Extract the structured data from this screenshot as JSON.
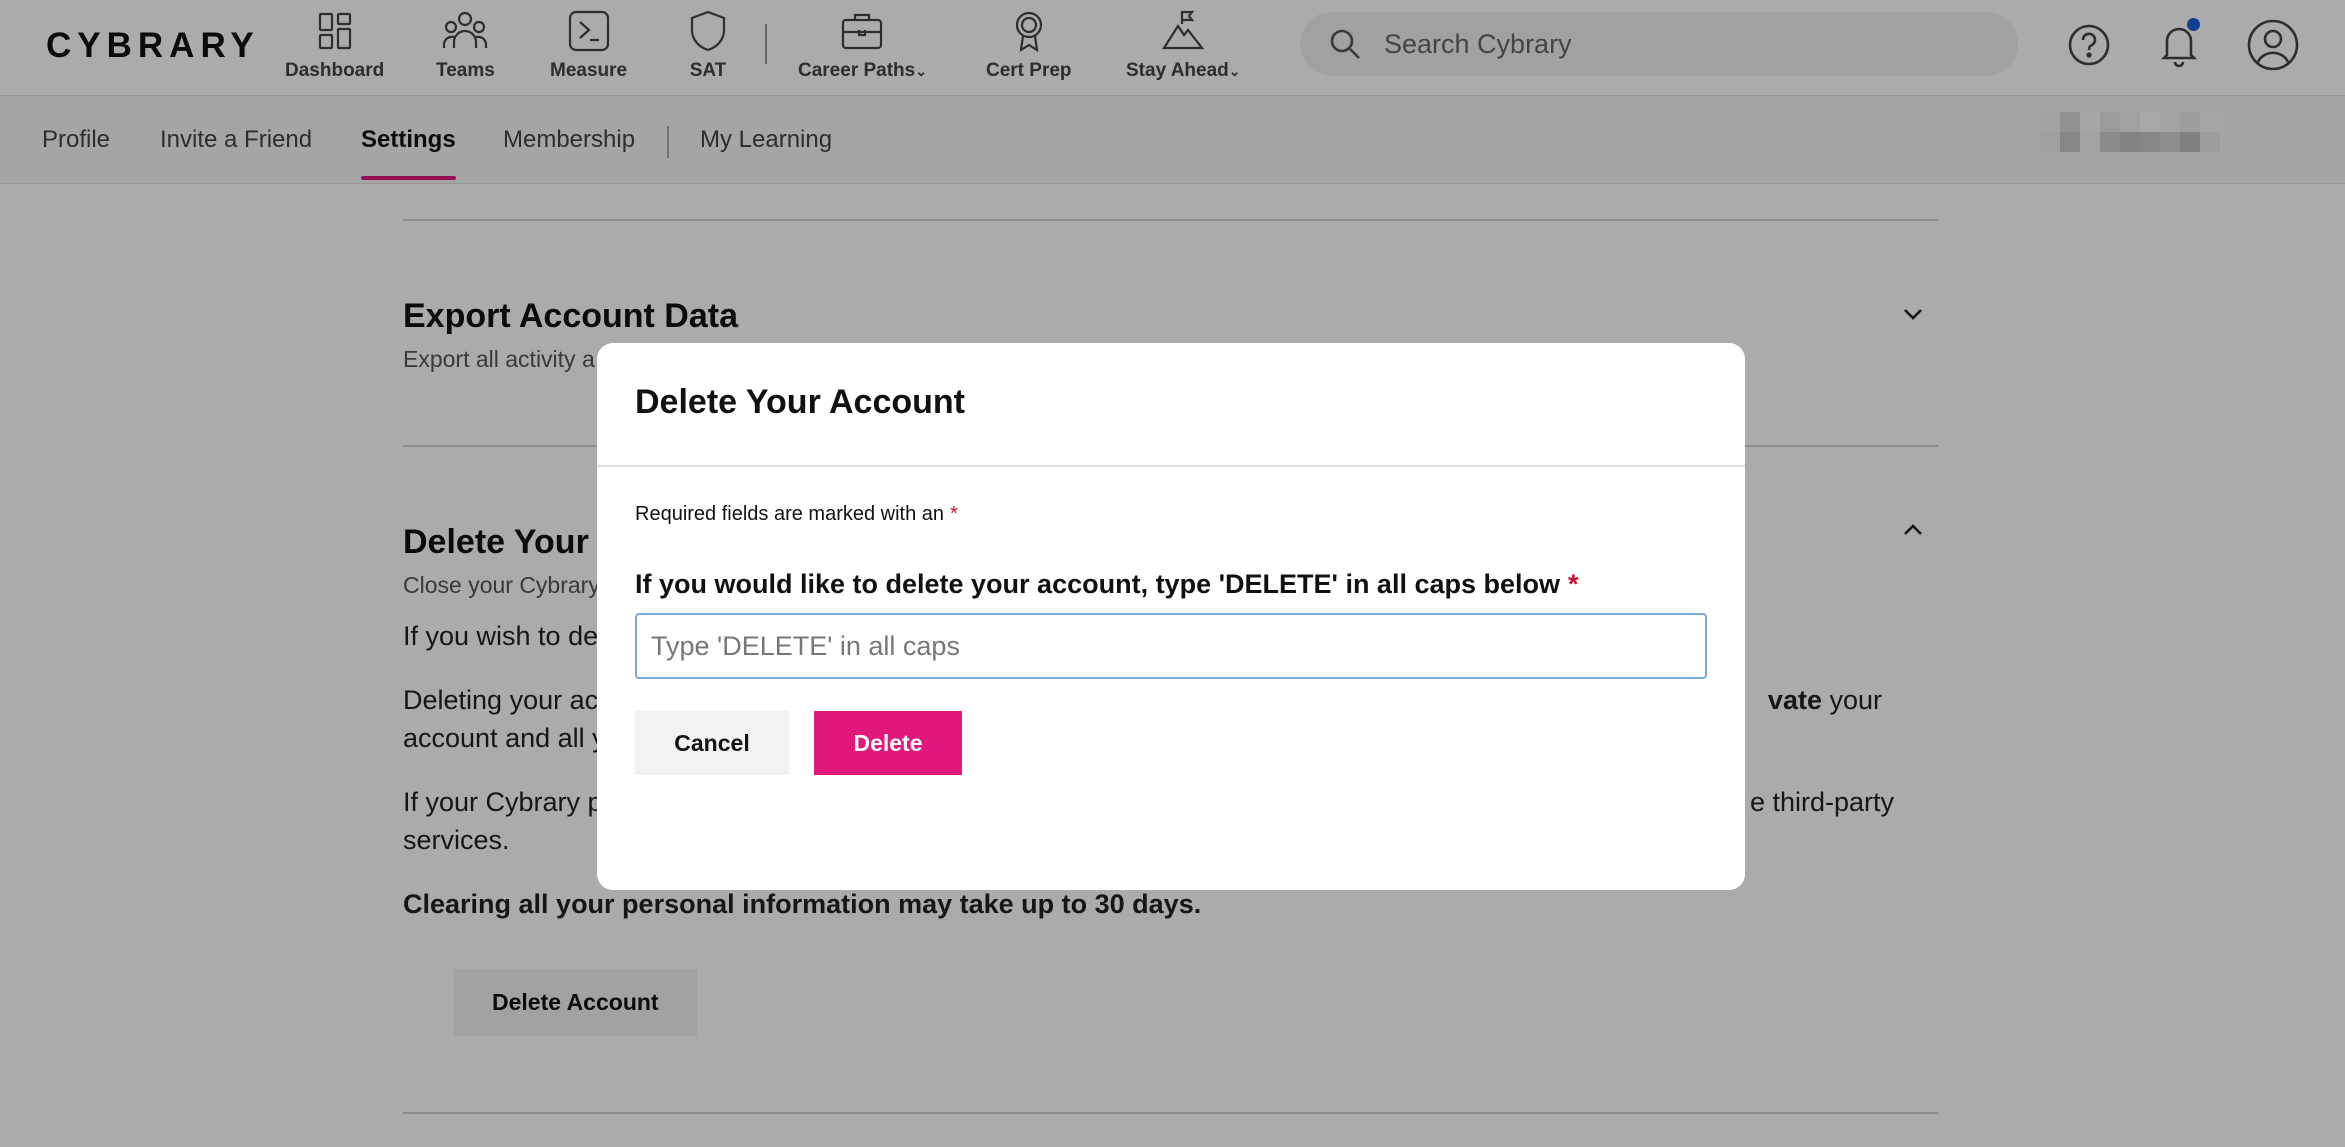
{
  "logo": "CYBRARY",
  "topnav": {
    "items": [
      {
        "label": "Dashboard",
        "icon": "dashboard-icon"
      },
      {
        "label": "Teams",
        "icon": "teams-icon"
      },
      {
        "label": "Measure",
        "icon": "terminal-icon"
      },
      {
        "label": "SAT",
        "icon": "shield-icon"
      },
      {
        "label": "Career Paths",
        "icon": "briefcase-icon",
        "dropdown": true
      },
      {
        "label": "Cert Prep",
        "icon": "award-icon"
      },
      {
        "label": "Stay Ahead",
        "icon": "mountain-flag-icon",
        "dropdown": true
      }
    ],
    "search_placeholder": "Search Cybrary"
  },
  "subnav": {
    "tabs": [
      "Profile",
      "Invite a Friend",
      "Settings",
      "Membership",
      "My Learning"
    ],
    "active": "Settings"
  },
  "page": {
    "export": {
      "title": "Export Account Data",
      "subtitle": "Export all activity a"
    },
    "delete": {
      "title": "Delete Your A",
      "subtitle": "Close your Cybrary",
      "p1": "If you wish to de",
      "p2a": "Deleting your ac",
      "p2b": "vate",
      "p2c": " your",
      "p2d": "account and all y",
      "p3a": "If your Cybrary p",
      "p3b": "e third-party",
      "p3c": "services.",
      "note": "Clearing all your personal information may take up to 30 days.",
      "button": "Delete Account"
    }
  },
  "modal": {
    "title": "Delete Your Account",
    "required_note": "Required fields are marked with an",
    "asterisk": "*",
    "field_label": "If you would like to delete your account, type 'DELETE' in all caps below",
    "field_placeholder": "Type 'DELETE' in all caps",
    "cancel": "Cancel",
    "delete": "Delete"
  },
  "colors": {
    "accent": "#e0187c",
    "required": "#c8102e",
    "notification": "#1860d8",
    "input_border": "#7aaad8"
  }
}
